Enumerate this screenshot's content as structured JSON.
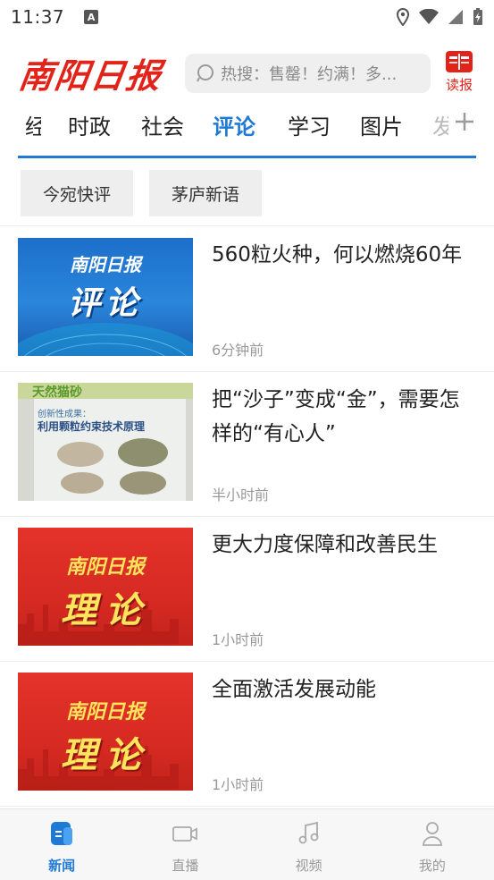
{
  "status_bar": {
    "time": "11:37",
    "notification_glyph": "A"
  },
  "header": {
    "logo_text": "南阳日报",
    "search_placeholder": "热搜：售罄！约满！多...",
    "read_label": "读报"
  },
  "tabs": {
    "partial_left": "经济",
    "items": [
      "时政",
      "社会",
      "评论",
      "学习",
      "图片"
    ],
    "active_index": 2,
    "partial_right": "发"
  },
  "subtags": [
    "今宛快评",
    "茅庐新语"
  ],
  "news": [
    {
      "title": "560粒火种，何以燃烧60年",
      "time": "6分钟前",
      "thumb": {
        "type": "blue",
        "line1": "南阳日报",
        "line2": "评论"
      }
    },
    {
      "title": "把“沙子”变成“金”，需要怎样的“有心人”",
      "time": "半小时前",
      "thumb": {
        "type": "photo",
        "line1": "天然猫砂",
        "line2": "创新性成果：",
        "line3": "利用颗粒约束技术原理"
      }
    },
    {
      "title": "更大力度保障和改善民生",
      "time": "1小时前",
      "thumb": {
        "type": "red",
        "line1": "南阳日报",
        "line2": "理论"
      }
    },
    {
      "title": "全面激活发展动能",
      "time": "1小时前",
      "thumb": {
        "type": "red",
        "line1": "南阳日报",
        "line2": "理论"
      }
    }
  ],
  "bottom_nav": [
    {
      "label": "新闻",
      "icon": "news-icon",
      "active": true
    },
    {
      "label": "直播",
      "icon": "live-camera-icon",
      "active": false
    },
    {
      "label": "视频",
      "icon": "music-note-icon",
      "active": false
    },
    {
      "label": "我的",
      "icon": "person-icon",
      "active": false
    }
  ],
  "colors": {
    "brand_red": "#e2231a",
    "accent_blue": "#1f7ad6"
  }
}
